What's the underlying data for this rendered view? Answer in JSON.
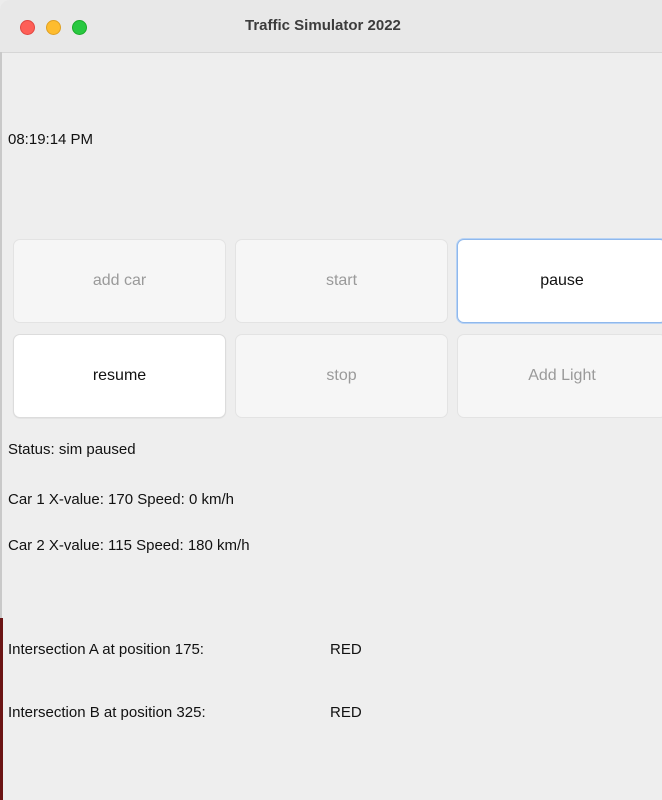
{
  "window": {
    "title": "Traffic Simulator 2022"
  },
  "clock": "08:19:14 PM",
  "buttons": {
    "add_car": "add car",
    "start": "start",
    "pause": "pause",
    "resume": "resume",
    "stop": "stop",
    "add_light": "Add Light"
  },
  "status": "Status: sim paused",
  "cars": [
    {
      "label": "Car 1 X-value: 170 Speed: 0 km/h"
    },
    {
      "label": "Car 2 X-value: 115 Speed: 180 km/h"
    }
  ],
  "intersections": [
    {
      "label": "Intersection A at position 175:",
      "state": "RED"
    },
    {
      "label": "Intersection B at position 325:",
      "state": "RED"
    }
  ],
  "colors": {
    "close": "#fe5f57",
    "minimize": "#febc2e",
    "maximize": "#28c840",
    "focus_ring": "#8fb8ec"
  }
}
